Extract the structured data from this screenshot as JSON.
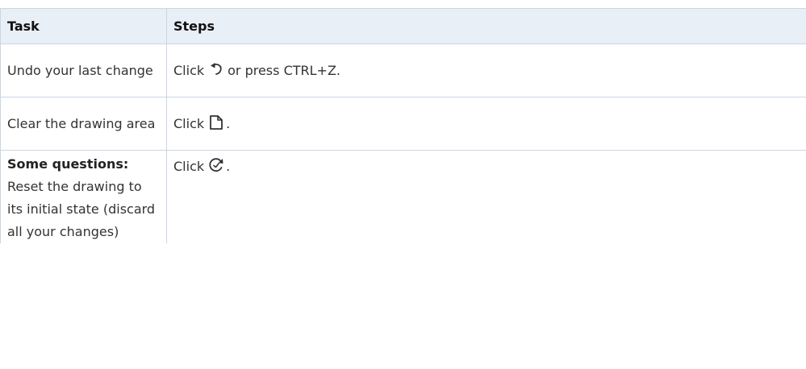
{
  "table": {
    "headers": {
      "task": "Task",
      "steps": "Steps"
    },
    "rows": [
      {
        "task": "Undo your last change",
        "steps": {
          "prefix": "Click",
          "icon": "undo-icon",
          "suffix": "or press CTRL+Z."
        }
      },
      {
        "task": "Clear the drawing area",
        "steps": {
          "prefix": "Click",
          "icon": "new-page-icon",
          "suffix": "."
        }
      },
      {
        "task_heading": "Some questions:",
        "task": "Reset the drawing to its initial state (discard all your changes)",
        "steps": {
          "prefix": "Click",
          "icon": "reset-icon",
          "suffix": "."
        }
      }
    ]
  }
}
